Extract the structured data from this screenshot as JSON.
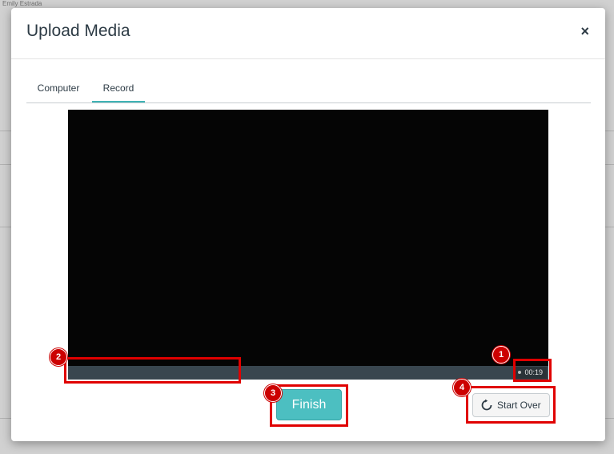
{
  "background": {
    "user_name": "Emily Estrada"
  },
  "modal": {
    "title": "Upload Media",
    "close_label": "×",
    "tabs": [
      {
        "label": "Computer",
        "active": false
      },
      {
        "label": "Record",
        "active": true
      }
    ],
    "recorder": {
      "elapsed_time": "00:19"
    },
    "finish_label": "Finish",
    "start_over_label": "Start Over"
  },
  "annotations": [
    {
      "number": "1"
    },
    {
      "number": "2"
    },
    {
      "number": "3"
    },
    {
      "number": "4"
    }
  ],
  "colors": {
    "accent": "#4cbfc1",
    "tab_underline": "#3fb3b5",
    "annotation": "#e00000",
    "video_bg": "#050505",
    "progress_bg": "#39464f"
  }
}
